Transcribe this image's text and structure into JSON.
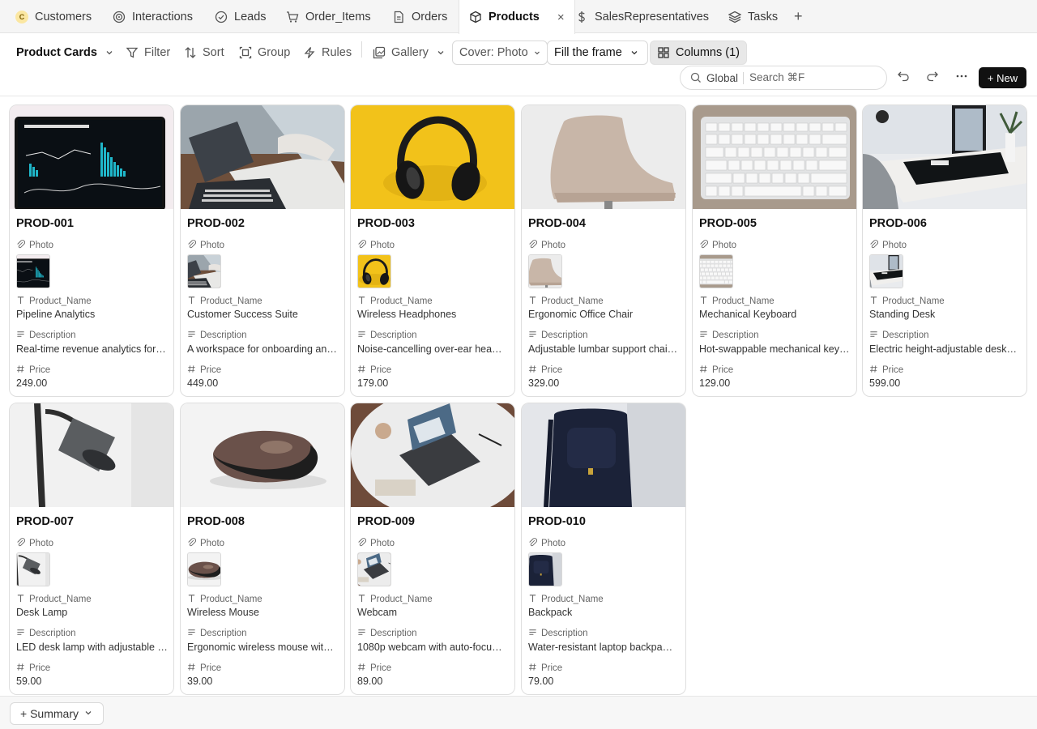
{
  "tabs": [
    {
      "label": "Customers",
      "icon": "customers-badge-icon"
    },
    {
      "label": "Interactions",
      "icon": "interactions-icon"
    },
    {
      "label": "Leads",
      "icon": "check-circle-icon"
    },
    {
      "label": "Order_Items",
      "icon": "cart-icon"
    },
    {
      "label": "Orders",
      "icon": "document-icon"
    },
    {
      "label": "Products",
      "icon": "box-icon",
      "active": true
    },
    {
      "label": "SalesRepresentatives",
      "icon": "dollar-icon"
    },
    {
      "label": "Tasks",
      "icon": "layers-icon"
    }
  ],
  "customers_badge": "C",
  "tab_close": "×",
  "tab_add": "+",
  "toolbar": {
    "view_name": "Product Cards",
    "filter": "Filter",
    "sort": "Sort",
    "group": "Group",
    "rules": "Rules",
    "layout": "Gallery",
    "cover": "Cover: Photo",
    "fit": "Fill the frame",
    "columns": "Columns (1)"
  },
  "search": {
    "scope": "Global",
    "placeholder": "Search ⌘F"
  },
  "new_button": "+ New",
  "field_labels": {
    "photo": "Photo",
    "name": "Product_Name",
    "description": "Description",
    "price": "Price"
  },
  "products": [
    {
      "id": "PROD-001",
      "name": "Pipeline Analytics",
      "description": "Real-time revenue analytics for…",
      "price": "249.00",
      "image": "analytics-laptop"
    },
    {
      "id": "PROD-002",
      "name": "Customer Success Suite",
      "description": "A workspace for onboarding an…",
      "price": "449.00",
      "image": "laptop-meeting"
    },
    {
      "id": "PROD-003",
      "name": "Wireless Headphones",
      "description": "Noise-cancelling over-ear hea…",
      "price": "179.00",
      "image": "headphones"
    },
    {
      "id": "PROD-004",
      "name": "Ergonomic Office Chair",
      "description": "Adjustable lumbar support chai…",
      "price": "329.00",
      "image": "office-chair"
    },
    {
      "id": "PROD-005",
      "name": "Mechanical Keyboard",
      "description": "Hot-swappable mechanical key…",
      "price": "129.00",
      "image": "keyboard"
    },
    {
      "id": "PROD-006",
      "name": "Standing Desk",
      "description": "Electric height-adjustable desk…",
      "price": "599.00",
      "image": "standing-desk"
    },
    {
      "id": "PROD-007",
      "name": "Desk Lamp",
      "description": "LED desk lamp with adjustable …",
      "price": "59.00",
      "image": "desk-lamp"
    },
    {
      "id": "PROD-008",
      "name": "Wireless Mouse",
      "description": "Ergonomic wireless mouse wit…",
      "price": "39.00",
      "image": "mouse"
    },
    {
      "id": "PROD-009",
      "name": "Webcam",
      "description": "1080p webcam with auto-focu…",
      "price": "89.00",
      "image": "laptop-table"
    },
    {
      "id": "PROD-010",
      "name": "Backpack",
      "description": "Water-resistant laptop backpa…",
      "price": "79.00",
      "image": "backpack"
    }
  ],
  "summary": "+ Summary"
}
